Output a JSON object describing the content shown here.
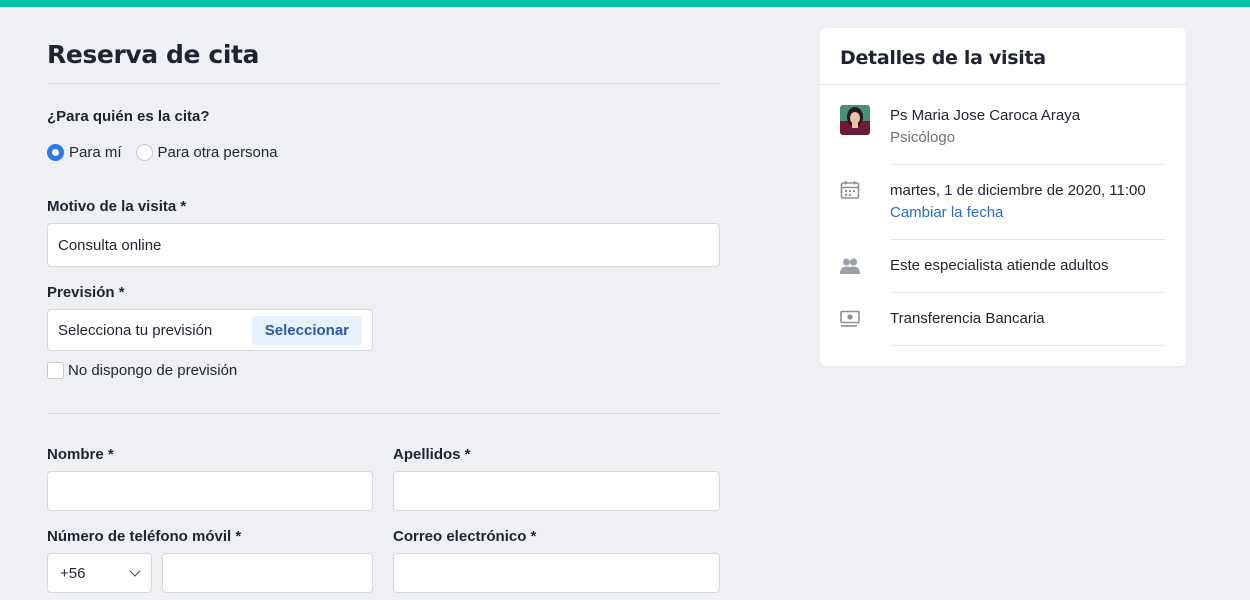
{
  "form": {
    "title": "Reserva de cita",
    "for_whom_label": "¿Para quién es la cita?",
    "radio_options": [
      "Para mí",
      "Para otra persona"
    ],
    "selected_option": "Para mí",
    "motivo_label": "Motivo de la visita *",
    "motivo_value": "Consulta online",
    "prevision_label": "Previsión *",
    "prevision_placeholder": "Selecciona tu previsión",
    "prevision_button": "Seleccionar",
    "no_prevision_label": "No dispongo de previsión",
    "nombre_label": "Nombre *",
    "apellidos_label": "Apellidos *",
    "telefono_label": "Número de teléfono móvil *",
    "phone_code": "+56",
    "correo_label": "Correo electrónico *"
  },
  "details": {
    "title": "Detalles de la visita",
    "doctor_name": "Ps Maria Jose Caroca Araya",
    "doctor_role": "Psicólogo",
    "date": "martes, 1 de diciembre de 2020, 11:00",
    "change_date": "Cambiar la fecha",
    "audience": "Este especialista atiende adultos",
    "payment": "Transferencia Bancaria"
  },
  "icons": {
    "calendar": "calendar-icon",
    "people": "people-icon",
    "payment": "banknote-icon"
  },
  "colors": {
    "accent": "#00c3a5",
    "primary": "#2b7be5",
    "link": "#2a6bc4",
    "background": "#eef0f3"
  }
}
